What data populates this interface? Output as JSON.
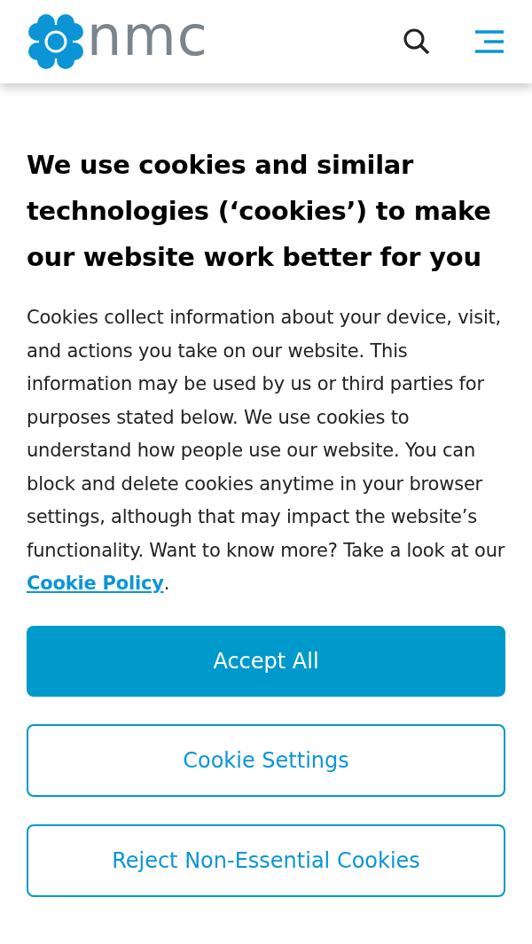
{
  "header": {
    "logo_text": "nmc"
  },
  "banner": {
    "title": "We use cookies and similar technologies (‘cookies’) to make our website work better for you",
    "body": "Cookies collect information about your device, visit, and actions you take on our website. This information may be used by us or third parties for purposes stated below. We use cookies to understand how people use our website. You can block and delete cookies anytime in your browser settings, although that may impact the website’s functionality. Want to know more? Take a look at our ",
    "link": "Cookie Policy",
    "after_link": ".",
    "buttons": [
      {
        "label": "Accept All",
        "kind": "primary"
      },
      {
        "label": "Cookie Settings",
        "kind": "outline"
      },
      {
        "label": "Reject Non-Essential Cookies",
        "kind": "outline"
      }
    ]
  }
}
